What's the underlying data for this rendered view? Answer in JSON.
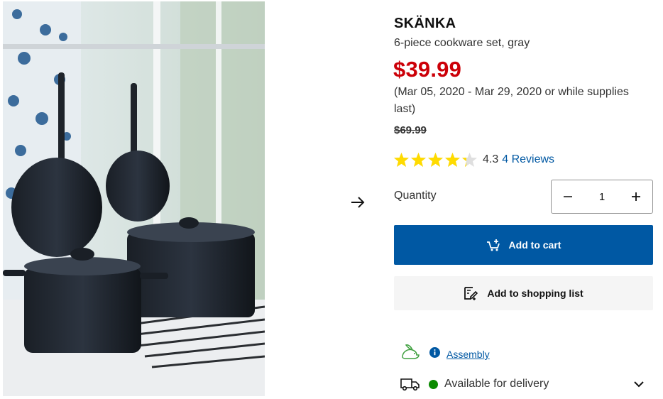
{
  "product": {
    "name": "SKÄNKA",
    "description": "6-piece cookware set, gray",
    "price": "$39.99",
    "validity": "(Mar 05, 2020 - Mar 29, 2020 or while supplies last)",
    "old_price": "$69.99",
    "image_icon": "cookware-photo"
  },
  "rating": {
    "score": "4.3",
    "stars_value": 4.3,
    "stars_max": 5,
    "reviews_label": "4 Reviews",
    "star_color": "#ffdb00"
  },
  "quantity": {
    "label": "Quantity",
    "value": "1",
    "decrement_icon": "minus-icon",
    "increment_icon": "plus-icon"
  },
  "actions": {
    "add_to_cart": "Add to cart",
    "add_to_cart_icon": "cart-plus-icon",
    "add_to_list": "Add to shopping list",
    "add_to_list_icon": "list-edit-icon",
    "primary_color": "#0058a3",
    "secondary_bg": "#f5f5f5"
  },
  "info": {
    "assembly_label": "Assembly",
    "assembly_icon": "rabbit-icon",
    "info_icon": "info-icon",
    "delivery_label": "Available for delivery",
    "delivery_icon": "truck-icon",
    "delivery_status_color": "#0a8a00",
    "expand_icon": "chevron-down-icon"
  },
  "gallery": {
    "next_icon": "arrow-right-icon"
  },
  "colors": {
    "price_red": "#cc0008",
    "link_blue": "#0058a3"
  }
}
